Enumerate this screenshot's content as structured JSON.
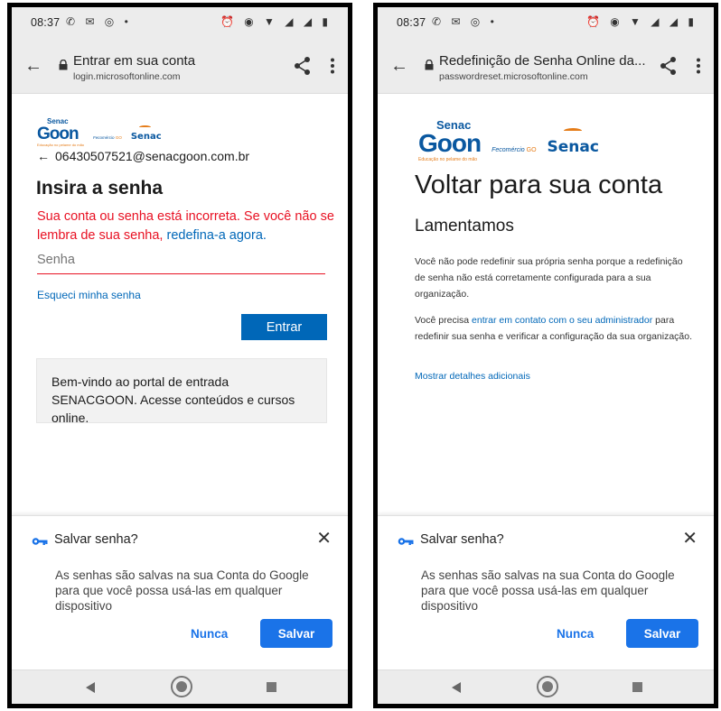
{
  "left": {
    "status_time": "08:37",
    "status_icons_left": "✆ ✉ ◎ •",
    "status_icons_right": "⏰ ◉ ▼ ◢ ◢ ▮",
    "page_title": "Entrar em sua conta",
    "page_url": "login.microsoftonline.com",
    "logo": {
      "senac_small": "Senac",
      "goon": "Goon",
      "tagline": "Educação no pelame do mão",
      "feco": "Fecomércio",
      "feco_go": "GO",
      "senac": "Senac"
    },
    "account": "06430507521@senacgoon.com.br",
    "heading": "Insira a senha",
    "error_text": "Sua conta ou senha está incorreta. Se você não se lembra de sua senha, ",
    "error_link": "redefina-a agora.",
    "password_placeholder": "Senha",
    "forgot": "Esqueci minha senha",
    "enter_button": "Entrar",
    "welcome": "Bem-vindo ao portal de entrada SENACGOON. Acesse conteúdos e cursos online."
  },
  "right": {
    "status_time": "08:37",
    "status_icons_left": "✆ ✉ ◎ •",
    "status_icons_right": "⏰ ◉ ▼ ◢ ◢ ▮",
    "page_title": "Redefinição de Senha Online da...",
    "page_url": "passwordreset.microsoftonline.com",
    "logo": {
      "senac_small": "Senac",
      "goon": "Goon",
      "tagline": "Educação no pelame do mão",
      "feco": "Fecomércio",
      "feco_go": "GO",
      "senac": "Senac"
    },
    "heading": "Voltar para sua conta",
    "sorry": "Lamentamos",
    "msg1": "Você não pode redefinir sua própria senha porque a redefinição de senha não está corretamente configurada para a sua organização.",
    "msg2_before": "Você precisa ",
    "msg2_link": "entrar em contato com o seu administrador",
    "msg2_after": " para redefinir sua senha e verificar a configuração da sua organização.",
    "details": "Mostrar detalhes adicionais"
  },
  "save_sheet": {
    "title": "Salvar senha?",
    "description": "As senhas são salvas na sua Conta do Google para que você possa usá-las em qualquer dispositivo",
    "never": "Nunca",
    "save": "Salvar"
  },
  "colors": {
    "ms_blue": "#0067b8",
    "error_red": "#e81123",
    "google_blue": "#1a73e8",
    "senac_blue": "#0a58a0",
    "senac_orange": "#e57c18"
  }
}
